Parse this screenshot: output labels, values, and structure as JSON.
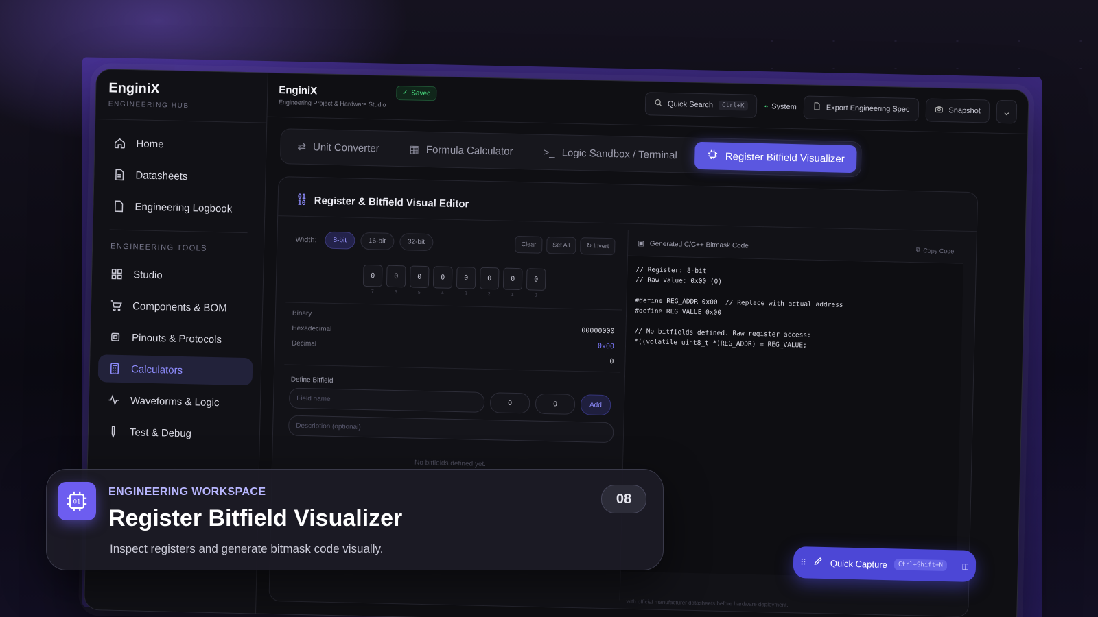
{
  "sidebar": {
    "brand_title": "EnginiX",
    "brand_sub": "ENGINEERING HUB",
    "primary": [
      {
        "label": "Home",
        "icon": "home-icon"
      },
      {
        "label": "Datasheets",
        "icon": "document-icon"
      },
      {
        "label": "Engineering Logbook",
        "icon": "file-icon"
      }
    ],
    "section_label": "ENGINEERING TOOLS",
    "tools": [
      {
        "label": "Studio",
        "icon": "grid-icon"
      },
      {
        "label": "Components & BOM",
        "icon": "cart-icon"
      },
      {
        "label": "Pinouts & Protocols",
        "icon": "chip-icon"
      },
      {
        "label": "Calculators",
        "icon": "calculator-icon",
        "active": true
      },
      {
        "label": "Waveforms & Logic",
        "icon": "waveform-icon"
      },
      {
        "label": "Test & Debug",
        "icon": "probe-icon"
      }
    ]
  },
  "topbar": {
    "title": "EnginiX",
    "subtitle": "Engineering Project & Hardware Studio",
    "saved_label": "Saved",
    "search_placeholder": "Quick Search",
    "search_shortcut": "Ctrl+K",
    "system_label": "System",
    "export_label": "Export Engineering Spec",
    "snapshot_label": "Snapshot"
  },
  "tabs": [
    {
      "label": "Unit Converter",
      "icon": "swap-icon"
    },
    {
      "label": "Formula Calculator",
      "icon": "calculator-icon"
    },
    {
      "label": "Logic Sandbox / Terminal",
      "icon": "terminal-icon"
    },
    {
      "label": "Register Bitfield Visualizer",
      "icon": "chip-icon",
      "active": true
    }
  ],
  "editor": {
    "title": "Register & Bitfield Visual Editor",
    "width_label": "Width:",
    "widths": [
      "8-bit",
      "16-bit",
      "32-bit"
    ],
    "selected_width": "8-bit",
    "actions": [
      "Clear",
      "Set All",
      "Invert"
    ],
    "bits": [
      "0",
      "0",
      "0",
      "0",
      "0",
      "0",
      "0",
      "0"
    ],
    "bit_indices": [
      "7",
      "6",
      "5",
      "4",
      "3",
      "2",
      "1",
      "0"
    ],
    "binary_label": "Binary",
    "binary_value": "00000000",
    "hex_label": "Hexadecimal",
    "hex_value": "0x00",
    "decimal_label": "Decimal",
    "decimal_value": "0",
    "define_label": "Define Bitfield",
    "field_name_placeholder": "Field name",
    "start_value": "0",
    "end_value": "0",
    "add_label": "Add",
    "description_placeholder": "Description (optional)",
    "empty_note": "No bitfields defined yet."
  },
  "code": {
    "title": "Generated C/C++ Bitmask Code",
    "copy_label": "Copy Code",
    "lines": "// Register: 8-bit\n// Raw Value: 0x00 (0)\n\n#define REG_ADDR 0x00  // Replace with actual address\n#define REG_VALUE 0x00\n\n// No bitfields defined. Raw register access:\n*((volatile uint8_t *)REG_ADDR) = REG_VALUE;",
    "footer_note": "with official manufacturer datasheets before hardware deployment."
  },
  "overlay": {
    "eyebrow": "ENGINEERING WORKSPACE",
    "title": "Register Bitfield Visualizer",
    "description": "Inspect registers and generate bitmask code visually.",
    "number": "08"
  },
  "quick_capture": {
    "label": "Quick Capture",
    "shortcut": "Ctrl+Shift+N"
  },
  "colors": {
    "accent": "#5b57e0",
    "accent_light": "#8f8dff",
    "saved_green": "#4ade80"
  }
}
